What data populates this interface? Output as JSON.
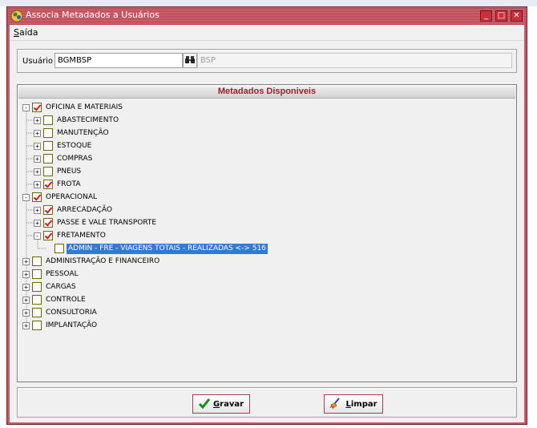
{
  "window": {
    "title": "Associa Metadados a Usuários",
    "controls": {
      "minimize": "_",
      "maximize": "□",
      "close": "✕"
    },
    "colors": {
      "titlebar": "#c0505c",
      "frame": "#c85a66",
      "selection": "#3379d6",
      "header_text": "#9a1e2a"
    }
  },
  "menu": {
    "items": [
      "Saída"
    ]
  },
  "user": {
    "label": "Usuário",
    "value": "BGMBSP",
    "description": "BSP",
    "lookup_icon": "binoculars-icon"
  },
  "tree": {
    "header": "Metadados Disponiveis",
    "nodes": [
      {
        "label": "OFICINA E MATERIAIS",
        "level": 0,
        "checked": true,
        "expander": "-"
      },
      {
        "label": "ABASTECIMENTO",
        "level": 1,
        "checked": false,
        "expander": "+"
      },
      {
        "label": "MANUTENÇÃO",
        "level": 1,
        "checked": false,
        "expander": "+"
      },
      {
        "label": "ESTOQUE",
        "level": 1,
        "checked": false,
        "expander": "+"
      },
      {
        "label": "COMPRAS",
        "level": 1,
        "checked": false,
        "expander": "+"
      },
      {
        "label": "PNEUS",
        "level": 1,
        "checked": false,
        "expander": "+"
      },
      {
        "label": "FROTA",
        "level": 1,
        "checked": true,
        "expander": "+"
      },
      {
        "label": "OPERACIONAL",
        "level": 0,
        "checked": true,
        "expander": "-"
      },
      {
        "label": "ARRECADAÇÃO",
        "level": 1,
        "checked": true,
        "expander": "+"
      },
      {
        "label": "PASSE E VALE TRANSPORTE",
        "level": 1,
        "checked": true,
        "expander": "+"
      },
      {
        "label": "FRETAMENTO",
        "level": 1,
        "checked": true,
        "expander": "-"
      },
      {
        "label": "ADMIN - FRE - VIAGENS  TOTAIS  - REALIZADAS <-> 516",
        "level": 2,
        "checked": false,
        "expander": "",
        "selected": true
      },
      {
        "label": "ADMINISTRAÇÃO E FINANCEIRO",
        "level": 0,
        "checked": false,
        "expander": "+"
      },
      {
        "label": "PESSOAL",
        "level": 0,
        "checked": false,
        "expander": "+"
      },
      {
        "label": "CARGAS",
        "level": 0,
        "checked": false,
        "expander": "+"
      },
      {
        "label": "CONTROLE",
        "level": 0,
        "checked": false,
        "expander": "+"
      },
      {
        "label": "CONSULTORIA",
        "level": 0,
        "checked": false,
        "expander": "+"
      },
      {
        "label": "IMPLANTAÇÃO",
        "level": 0,
        "checked": false,
        "expander": "+"
      }
    ]
  },
  "buttons": {
    "save": {
      "label": "Gravar",
      "icon": "checkmark-icon"
    },
    "clear": {
      "label": "Limpar",
      "icon": "broom-icon"
    }
  }
}
